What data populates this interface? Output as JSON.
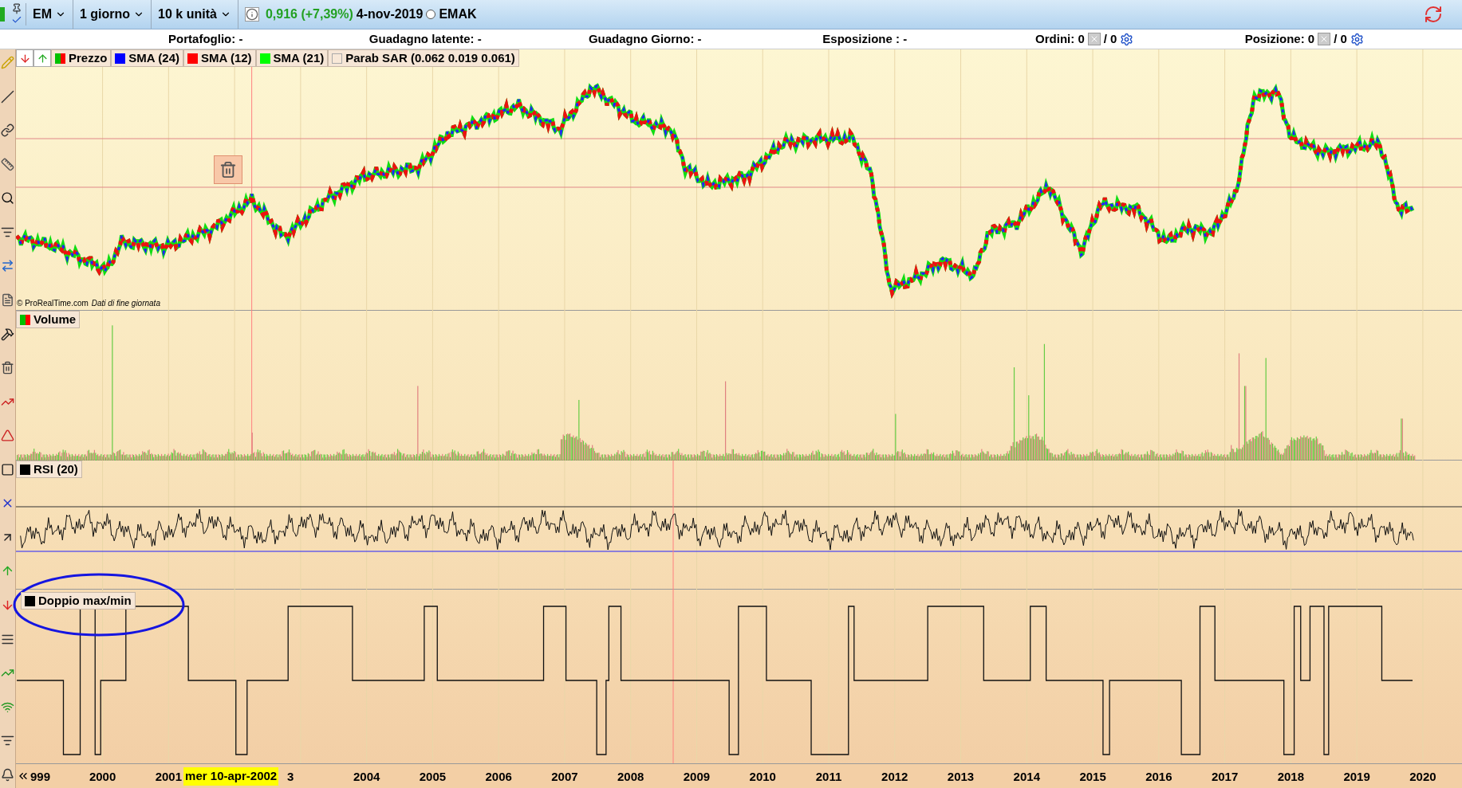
{
  "toolbar": {
    "symbol": "EM",
    "period": "1 giorno",
    "quantity": "10 k unità",
    "price": "0,916 (+7,39%)",
    "date": "4-nov-2019",
    "ticker": "EMAK"
  },
  "summary": [
    {
      "kind": "text",
      "label": "Portafoglio: -"
    },
    {
      "kind": "text",
      "label": "Guadagno latente: -"
    },
    {
      "kind": "text",
      "label": "Guadagno Giorno: -"
    },
    {
      "kind": "text",
      "label": "Esposizione : -"
    },
    {
      "kind": "orders",
      "label": "Ordini: 0",
      "tail": "/ 0"
    },
    {
      "kind": "orders",
      "label": "Posizione: 0",
      "tail": "/ 0"
    }
  ],
  "price_panel": {
    "legend": [
      {
        "kind": "split",
        "label": "Prezzo"
      },
      {
        "kind": "solid",
        "label": "SMA (24)",
        "color": "#0000ff"
      },
      {
        "kind": "solid",
        "label": "SMA (12)",
        "color": "#ff0000"
      },
      {
        "kind": "solid",
        "label": "SMA (21)",
        "color": "#00ff00"
      },
      {
        "kind": "empty",
        "label": "Parab SAR (0.062 0.019 0.061)"
      }
    ],
    "copyright": "© ProRealTime.com",
    "note": "Dati di fine giornata"
  },
  "volume_panel": {
    "legend": [
      {
        "kind": "split",
        "label": "Volume"
      }
    ]
  },
  "rsi_panel": {
    "legend": [
      {
        "kind": "solid",
        "label": "RSI (20)",
        "color": "#000000"
      }
    ]
  },
  "doppio_panel": {
    "legend": [
      {
        "kind": "solid",
        "label": "Doppio max/min",
        "color": "#000000"
      }
    ]
  },
  "x_axis": {
    "labels": [
      "999",
      "2000",
      "2001",
      "3",
      "2004",
      "2005",
      "2006",
      "2007",
      "2008",
      "2009",
      "2010",
      "2011",
      "2012",
      "2013",
      "2014",
      "2015",
      "2016",
      "2017",
      "2018",
      "2019",
      "2020"
    ],
    "cursor_tag": "mer 10-apr-2002"
  }
}
